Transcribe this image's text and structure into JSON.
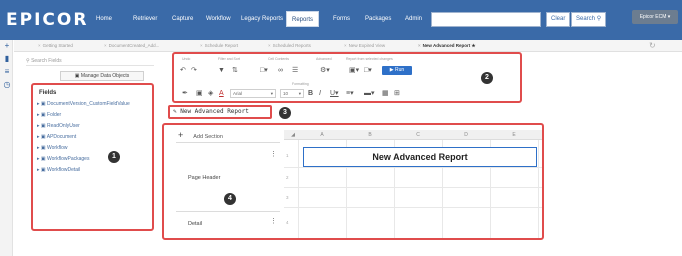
{
  "app": {
    "logo": "EPICOR",
    "nav": [
      "Home",
      "Retriever",
      "Capture",
      "Workflow",
      "Legacy Reports",
      "Reports",
      "Forms",
      "Packages",
      "Admin"
    ],
    "active_nav": "Reports",
    "search_placeholder": "",
    "clear_label": "Clear",
    "search_label": "Search",
    "user_label": "Epicor ECM"
  },
  "tabs": [
    {
      "label": "Getting Started"
    },
    {
      "label": "DocumentCreated_Add..."
    },
    {
      "label": "Schedule Report"
    },
    {
      "label": "Scheduled Reports"
    },
    {
      "label": "New Expired View"
    },
    {
      "label": "New Advanced Report"
    }
  ],
  "left_panel": {
    "search_placeholder": "Search Fields",
    "manage_label": "Manage Data Objects",
    "fields_title": "Fields",
    "fields": [
      "DocumentVersion_CustomFieldValue",
      "Folder",
      "ReadOnlyUser",
      "APDocument",
      "Workflow",
      "WorkflowPackages",
      "WorkflowDetail"
    ]
  },
  "ribbon": {
    "groups": [
      "Undo",
      "Filter and Sort",
      "Cell Contents",
      "Advanced",
      "Report from selected changes"
    ],
    "formatting_label": "Formatting",
    "run_label": "Run",
    "font_name": "Arial",
    "font_size": "10"
  },
  "report_name": "New Advanced Report",
  "designer": {
    "add_section_label": "Add Section",
    "columns": [
      "A",
      "B",
      "C",
      "D",
      "E"
    ],
    "rows": [
      "1",
      "2",
      "3",
      "4"
    ],
    "sections": [
      "Page Header",
      "Detail"
    ],
    "title_cell_text": "New Advanced Report"
  },
  "callouts": [
    "1",
    "2",
    "3",
    "4"
  ],
  "colors": {
    "nav_bg": "#3a6aa8",
    "callout_border": "#e04c4c",
    "accent": "#2e70c8"
  }
}
